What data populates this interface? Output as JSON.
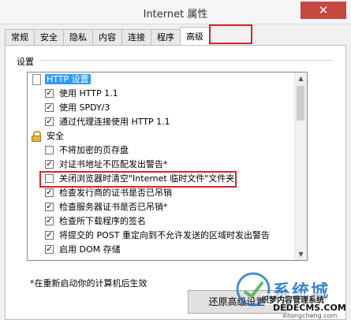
{
  "window": {
    "title": "Internet 属性",
    "close_label": "✕"
  },
  "tabs": [
    {
      "label": "常规",
      "active": false
    },
    {
      "label": "安全",
      "active": false
    },
    {
      "label": "隐私",
      "active": false
    },
    {
      "label": "内容",
      "active": false
    },
    {
      "label": "连接",
      "active": false
    },
    {
      "label": "程序",
      "active": false
    },
    {
      "label": "高级",
      "active": true
    }
  ],
  "settings": {
    "group_label": "设置",
    "items": [
      {
        "type": "category",
        "icon": "document-icon",
        "label": "HTTP 设置",
        "selected": true
      },
      {
        "type": "check",
        "checked": true,
        "label": "使用 HTTP 1.1"
      },
      {
        "type": "check",
        "checked": true,
        "label": "使用 SPDY/3"
      },
      {
        "type": "check",
        "checked": true,
        "label": "通过代理连接使用 HTTP 1.1"
      },
      {
        "type": "category",
        "icon": "lock-icon",
        "label": "安全"
      },
      {
        "type": "check",
        "checked": false,
        "label": "不将加密的页存盘"
      },
      {
        "type": "check",
        "checked": true,
        "label": "对证书地址不匹配发出警告*"
      },
      {
        "type": "check",
        "checked": false,
        "label": "关闭浏览器时清空\"Internet 临时文件\"文件夹",
        "highlighted": true
      },
      {
        "type": "check",
        "checked": true,
        "label": "检查发行商的证书是否已吊销"
      },
      {
        "type": "check",
        "checked": true,
        "label": "检查服务器证书是否已吊销*"
      },
      {
        "type": "check",
        "checked": true,
        "label": "检查所下载程序的签名"
      },
      {
        "type": "check",
        "checked": true,
        "label": "将提交的 POST 重定向到不允许发送的区域时发出警告"
      },
      {
        "type": "check",
        "checked": true,
        "label": "启用 DOM 存储"
      }
    ],
    "check_glyph": "✓"
  },
  "footer": {
    "note": "*在重新启动你的计算机后生效",
    "restore_label": "还原高级设置"
  },
  "watermark": {
    "text": "系统城",
    "sub": "织梦内容管理系统",
    "url": "DEDECMS.COM",
    "url2": "xitongcheng.com"
  },
  "colors": {
    "highlight_box": "#d8242c",
    "selection": "#3399ff",
    "close_button": "#c7463e"
  }
}
